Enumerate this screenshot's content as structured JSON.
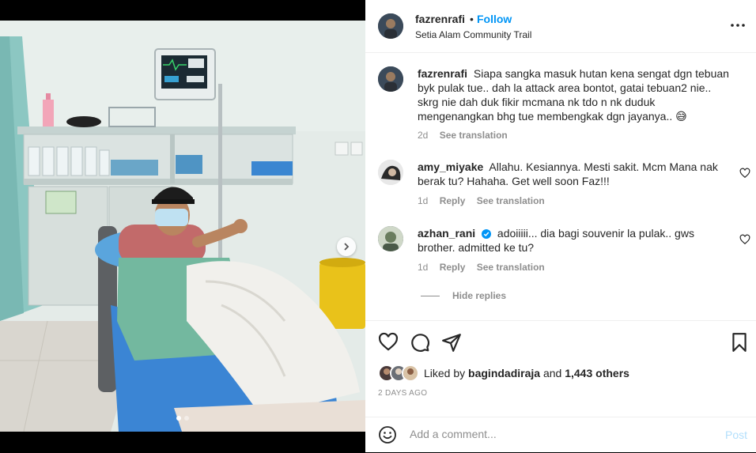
{
  "post": {
    "username": "fazrenrafi",
    "separator": "•",
    "follow_label": "Follow",
    "location": "Setia Alam Community Trail"
  },
  "caption": {
    "username": "fazrenrafi",
    "text": "Siapa sangka masuk hutan kena sengat dgn tebuan byk pulak tue.. dah la attack area bontot, gatai tebuan2 nie.. skrg nie dah duk fikir mcmana nk tdo n nk duduk mengenangkan bhg tue membengkak dgn jayanya.. 😅",
    "age": "2d",
    "see_translation": "See translation"
  },
  "comments": [
    {
      "username": "amy_miyake",
      "text": "Allahu. Kesiannya. Mesti sakit. Mcm Mana nak berak tu? Hahaha. Get well soon Faz!!!",
      "age": "1d",
      "reply": "Reply",
      "see_translation": "See translation"
    },
    {
      "username": "azhan_rani",
      "verified": true,
      "text": "adoiiiii... dia bagi souvenir la pulak.. gws brother. admitted ke tu?",
      "age": "1d",
      "reply": "Reply",
      "see_translation": "See translation"
    }
  ],
  "hide_replies": "Hide replies",
  "likes": {
    "prefix": "Liked by",
    "first_liker": "bagindadiraja",
    "and": "and",
    "others": "1,443 others"
  },
  "date": "2 DAYS AGO",
  "add_comment": {
    "placeholder": "Add a comment...",
    "post_label": "Post"
  },
  "carousel": {
    "slides": 2,
    "active_index": 0
  },
  "colors": {
    "accent": "#0095f6",
    "muted": "#8e8e8e",
    "post_disabled": "#b2dffc"
  },
  "icons": [
    "more-options-icon",
    "heart-icon",
    "comment-icon",
    "share-icon",
    "bookmark-icon",
    "emoji-icon",
    "verified-badge-icon",
    "chevron-right-icon"
  ]
}
